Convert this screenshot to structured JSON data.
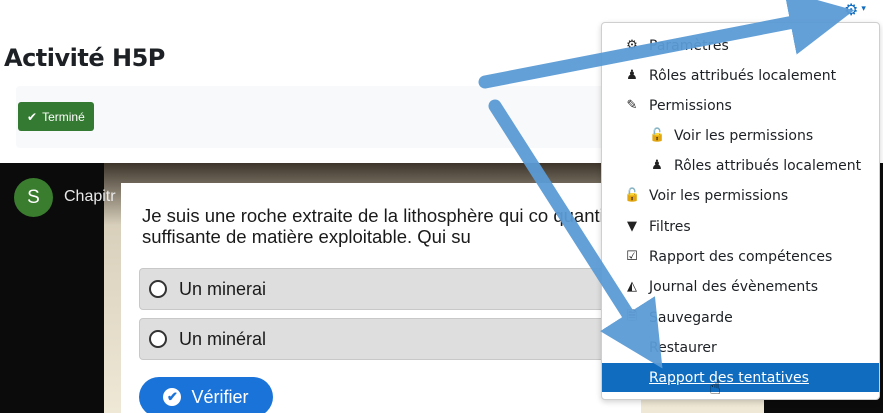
{
  "header": {
    "gear_icon": "gear-icon",
    "chevron_icon": "chevron-down-icon"
  },
  "page": {
    "title": "Activité H5P"
  },
  "completion": {
    "done_label": "Terminé",
    "icon": "check-icon"
  },
  "h5p": {
    "avatar_letter": "S",
    "chapter_label": "Chapitr",
    "question": "Je suis une roche extraite de la lithosphère qui co quantité suffisante de matière exploitable. Qui su",
    "answers": [
      "Un minerai",
      "Un minéral"
    ],
    "check_label": "Vérifier"
  },
  "menu": {
    "items": [
      {
        "label": "Paramètres",
        "icon": "gear-icon"
      },
      {
        "label": "Rôles attribués localement",
        "icon": "user-icon"
      },
      {
        "label": "Permissions",
        "icon": "edit-icon"
      },
      {
        "label": "Voir les permissions",
        "icon": "unlock-icon"
      },
      {
        "label": "Rôles attribués localement",
        "icon": "user-icon"
      },
      {
        "label": "Voir les permissions",
        "icon": "unlock-icon"
      },
      {
        "label": "Filtres",
        "icon": "filter-icon"
      },
      {
        "label": "Rapport des compétences",
        "icon": "checkbox-icon"
      },
      {
        "label": "Journal des évènements",
        "icon": "area-chart-icon"
      },
      {
        "label": "Sauvegarde",
        "icon": "file-archive-icon"
      },
      {
        "label": "Restaurer",
        "icon": ""
      },
      {
        "label": "Rapport des tentatives",
        "icon": ""
      }
    ]
  },
  "colors": {
    "accent": "#0f6cbf",
    "done": "#357a32",
    "check_button": "#1a73d9",
    "annotation_arrow": "#5b9bd5"
  }
}
